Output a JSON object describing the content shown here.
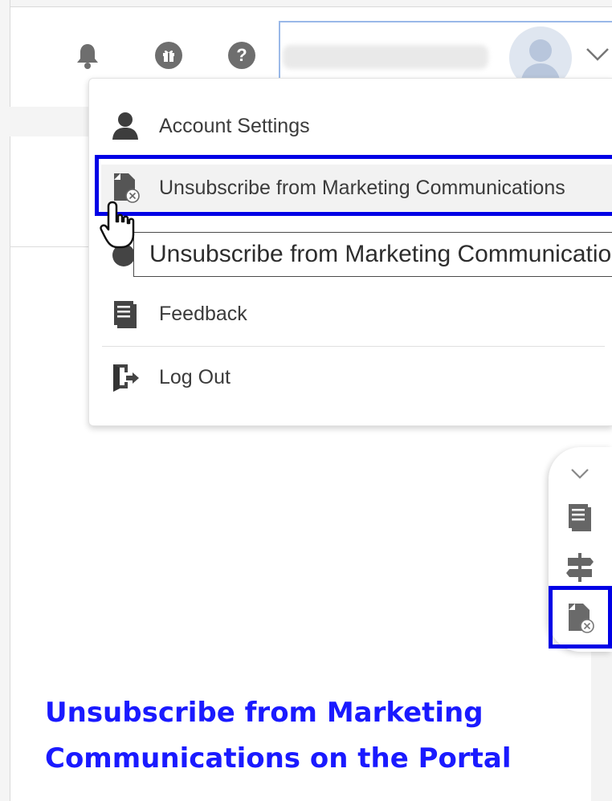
{
  "header": {
    "icons": [
      "bell-icon",
      "gift-icon",
      "help-icon"
    ],
    "user_name_blurred": "",
    "avatar_icon": "user-avatar-icon",
    "dropdown_icon": "chevron-down-icon"
  },
  "menu": {
    "items": [
      {
        "label": "Account Settings",
        "icon": "person-icon"
      },
      {
        "label": "Unsubscribe from Marketing Communications",
        "icon": "unsubscribe-document-icon"
      },
      {
        "label": "Feedback",
        "icon": "feedback-document-icon"
      },
      {
        "label": "Log Out",
        "icon": "logout-icon"
      }
    ]
  },
  "tooltip": {
    "text": "Unsubscribe from Marketing Communications"
  },
  "side_toolbar": {
    "icons": [
      "chevron-down-icon",
      "document-list-icon",
      "signpost-icon",
      "unsubscribe-document-icon"
    ]
  },
  "caption": {
    "line1": "Unsubscribe from Marketing",
    "line2": "Communications on the Portal"
  },
  "colors": {
    "highlight": "#0000e6",
    "caption": "#1a1aff",
    "icon_gray": "#6e6e6e",
    "menu_text": "#3b3b3b"
  }
}
